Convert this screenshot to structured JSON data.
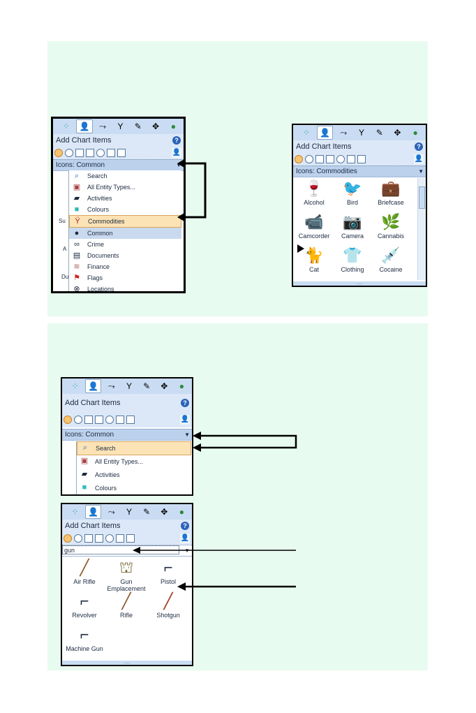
{
  "panel": {
    "title": "Add Chart Items",
    "help": "?",
    "combo_common": "Icons: Common",
    "combo_commodities": "Icons: Commodities",
    "search_value": "gun",
    "grip": "....."
  },
  "tabs": [
    "palette-icon",
    "person-icon",
    "link-icon",
    "filter-icon",
    "wand-icon",
    "move-icon",
    "globe-icon"
  ],
  "menu_long": [
    {
      "label": "Search",
      "icon": "🔍"
    },
    {
      "label": "All Entity Types...",
      "icon": "▣"
    },
    {
      "label": "Activities",
      "icon": "🎬"
    },
    {
      "label": "Colours",
      "icon": "■"
    },
    {
      "label": "Commodities",
      "icon": "🍷"
    },
    {
      "label": "Common",
      "icon": "👤"
    },
    {
      "label": "Crime",
      "icon": "⚙"
    },
    {
      "label": "Documents",
      "icon": "📄"
    },
    {
      "label": "Finance",
      "icon": "💵"
    },
    {
      "label": "Flags",
      "icon": "⚑"
    },
    {
      "label": "Locations",
      "icon": "⊗"
    }
  ],
  "menu_short": [
    {
      "label": "Search",
      "icon": "🔍"
    },
    {
      "label": "All Entity Types...",
      "icon": "▣"
    },
    {
      "label": "Activities",
      "icon": "🎬"
    },
    {
      "label": "Colours",
      "icon": "■"
    }
  ],
  "commodities": [
    {
      "label": "Alcohol",
      "icon": "🍷"
    },
    {
      "label": "Bird",
      "icon": "🐦"
    },
    {
      "label": "Briefcase",
      "icon": "💼"
    },
    {
      "label": "Camcorder",
      "icon": "📹"
    },
    {
      "label": "Camera",
      "icon": "📷"
    },
    {
      "label": "Cannabis",
      "icon": "🌿"
    },
    {
      "label": "Cat",
      "icon": "🐈"
    },
    {
      "label": "Clothing",
      "icon": "👕"
    },
    {
      "label": "Cocaine",
      "icon": "💉"
    }
  ],
  "guns": [
    {
      "label": "Air Rifle",
      "icon": "╱"
    },
    {
      "label": "Gun Emplacement",
      "icon": "⛫"
    },
    {
      "label": "Pistol",
      "icon": "⌐"
    },
    {
      "label": "Revolver",
      "icon": "⌐"
    },
    {
      "label": "Rifle",
      "icon": "╱"
    },
    {
      "label": "Shotgun",
      "icon": "╱"
    },
    {
      "label": "Machine Gun",
      "icon": "⌐"
    }
  ],
  "side_bits": [
    "Su",
    "A",
    "Du"
  ]
}
